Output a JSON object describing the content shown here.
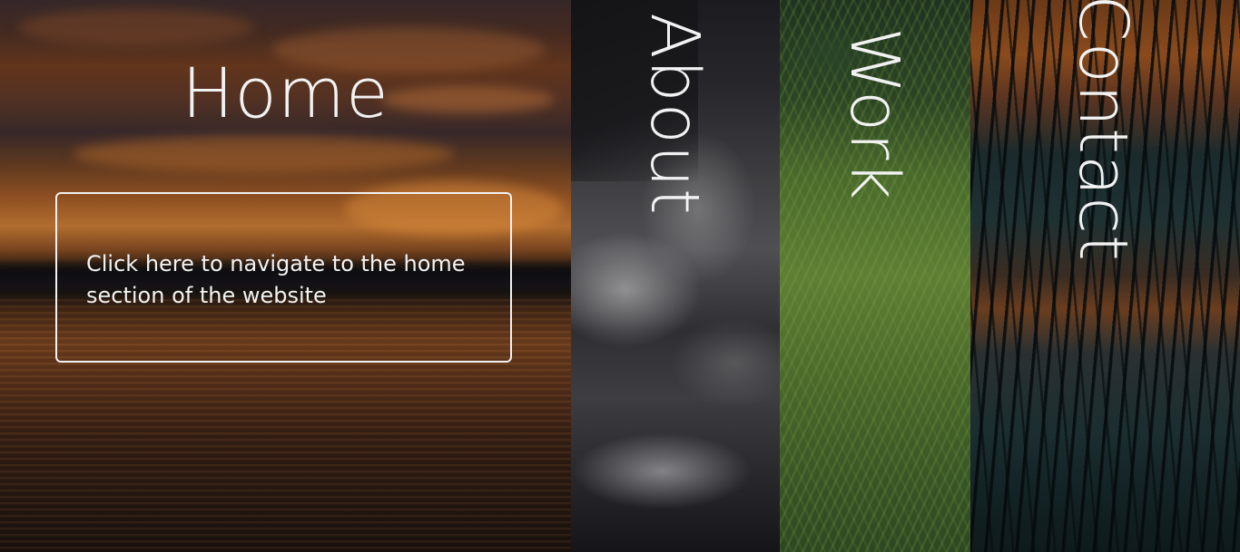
{
  "sections": {
    "home": {
      "title": "Home",
      "description": "Click here to navigate to the home section of the website"
    },
    "about": {
      "title": "About"
    },
    "work": {
      "title": "Work"
    },
    "contact": {
      "title": "Contact"
    }
  },
  "colors": {
    "text": "#f2f2f2",
    "box_border": "#f2f2f2"
  },
  "backgrounds": {
    "home": "sunset-over-water-photo",
    "about": "stormy-ocean-wave-photo",
    "work": "green-fern-foliage-photo",
    "contact": "reeds-silhouette-photo"
  }
}
